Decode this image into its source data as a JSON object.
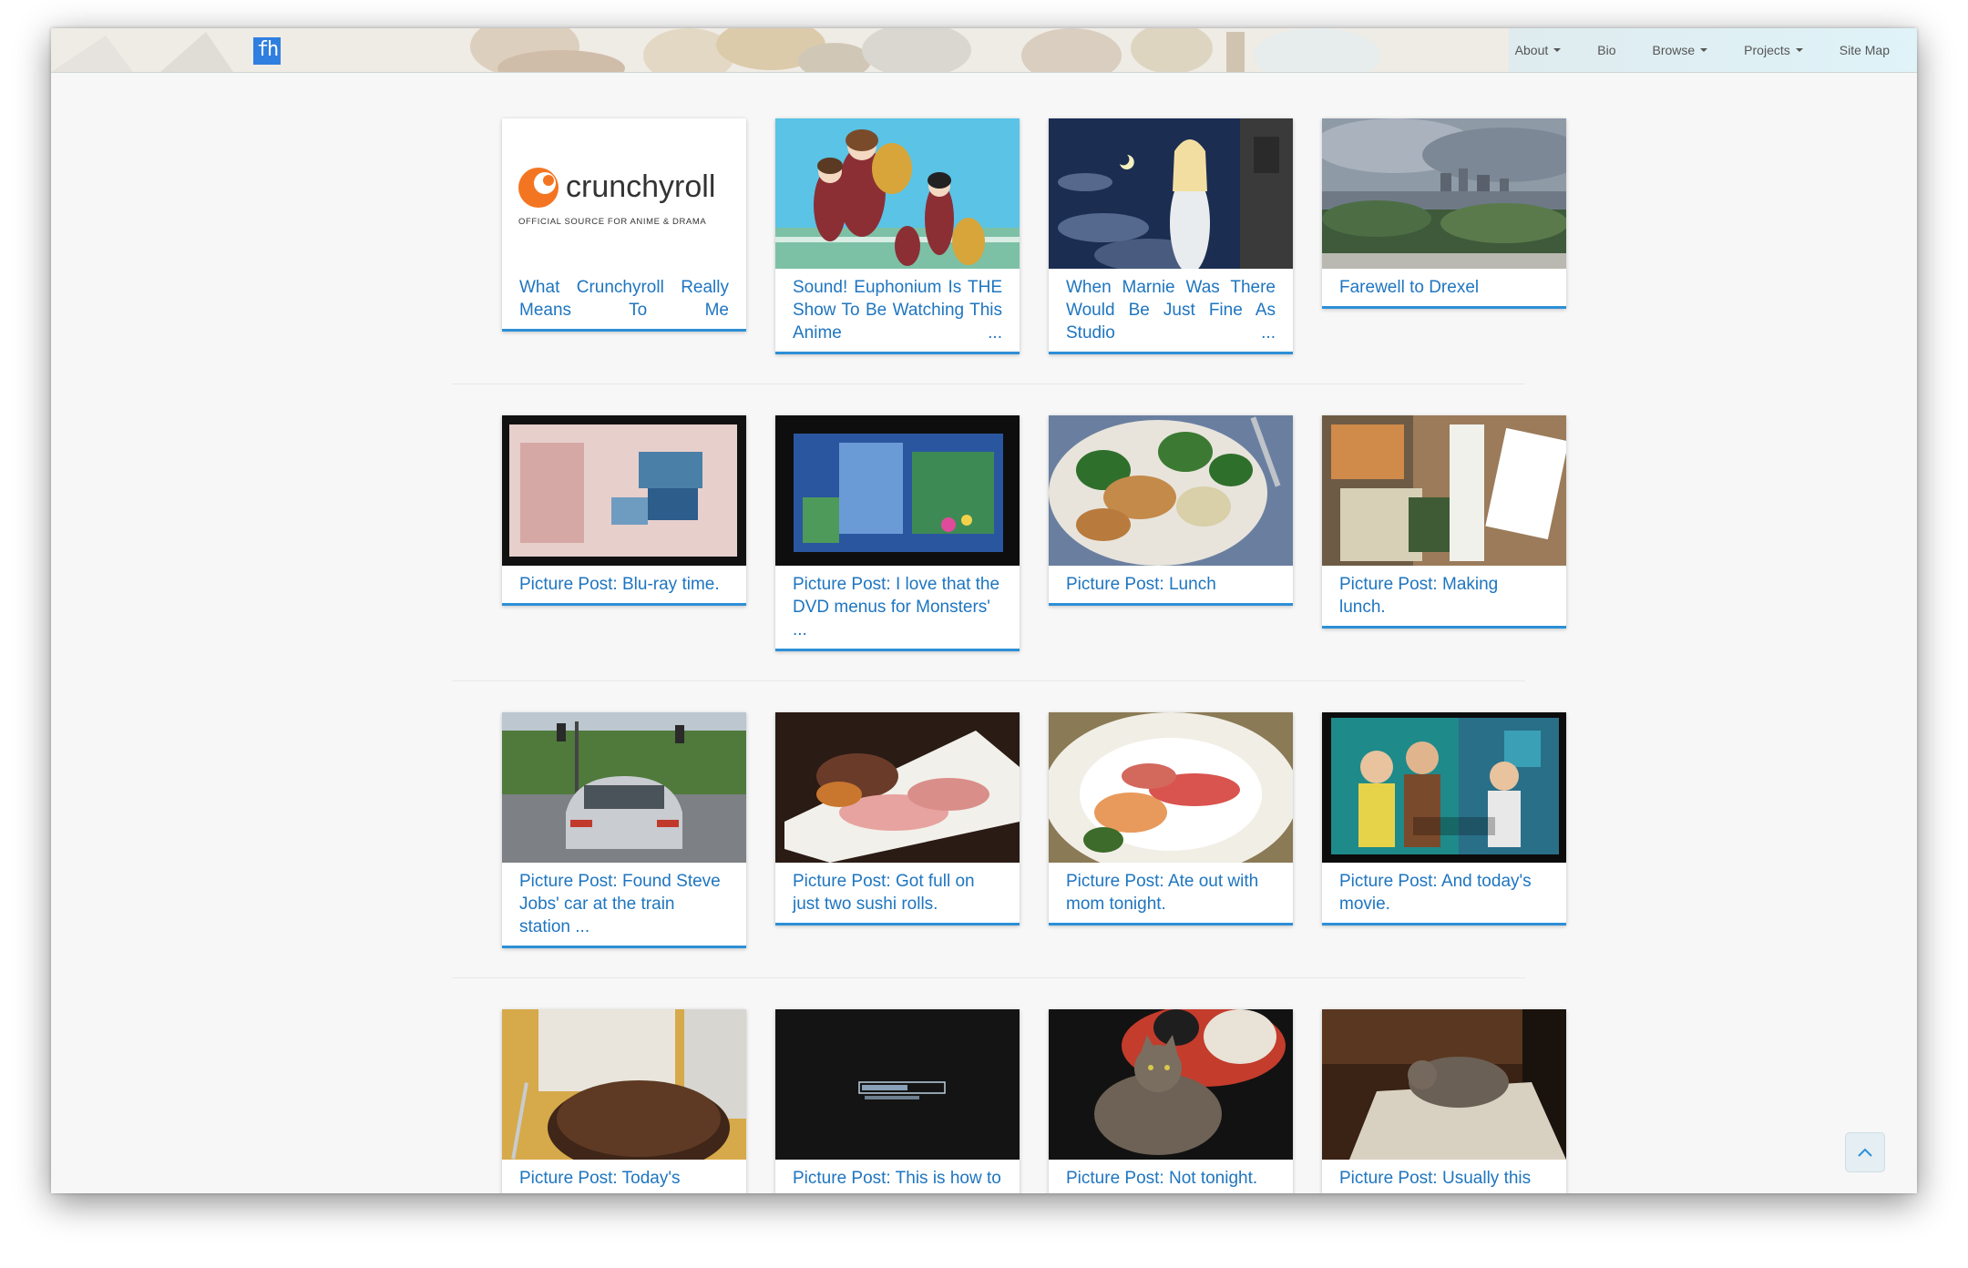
{
  "navbar": {
    "logo": "fh",
    "links": [
      {
        "label": "About",
        "dropdown": true
      },
      {
        "label": "Bio",
        "dropdown": false
      },
      {
        "label": "Browse",
        "dropdown": true
      },
      {
        "label": "Projects",
        "dropdown": true
      },
      {
        "label": "Site Map",
        "dropdown": false
      }
    ]
  },
  "crunchyroll_logo": {
    "name": "crunchyroll",
    "tagline": "OFFICIAL SOURCE FOR ANIME & DRAMA"
  },
  "posts": [
    {
      "title": "What Crunchyroll Really Means To Me"
    },
    {
      "title": "Sound! Euphonium Is THE Show To Be Watching This Anime ..."
    },
    {
      "title": "When Marnie Was There Would Be Just Fine As Studio ..."
    },
    {
      "title": "Farewell to Drexel"
    },
    {
      "title": "Picture Post: Blu-ray time."
    },
    {
      "title": "Picture Post: I love that the DVD menus for Monsters' ..."
    },
    {
      "title": "Picture Post: Lunch"
    },
    {
      "title": "Picture Post: Making lunch."
    },
    {
      "title": "Picture Post: Found Steve Jobs' car at the train station ..."
    },
    {
      "title": "Picture Post: Got full on just two sushi rolls."
    },
    {
      "title": "Picture Post: Ate out with mom tonight."
    },
    {
      "title": "Picture Post: And today's movie."
    },
    {
      "title": "Picture Post: Today's lunch."
    },
    {
      "title": "Picture Post: This is how to properly build a ..."
    },
    {
      "title": "Picture Post: Not tonight."
    },
    {
      "title": "Picture Post: Usually this trouble maker steals my ..."
    }
  ],
  "icons": {
    "scroll_top": "chevron-up-icon",
    "logo": "fh-logo-icon"
  },
  "colors": {
    "link": "#1e75c0",
    "card_border": "#2d8fd6",
    "logo_bg": "#2f7fe0"
  }
}
